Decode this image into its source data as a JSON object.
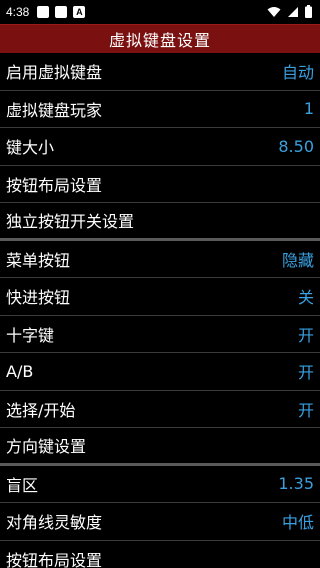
{
  "status": {
    "time": "4:38",
    "notif_a_glyph": "A"
  },
  "header": {
    "title": "虚拟键盘设置"
  },
  "rows": [
    {
      "label": "启用虚拟键盘",
      "value": "自动"
    },
    {
      "label": "虚拟键盘玩家",
      "value": "1"
    },
    {
      "label": "键大小",
      "value": "8.50"
    },
    {
      "label": "按钮布局设置",
      "value": ""
    },
    {
      "label": "独立按钮开关设置",
      "value": ""
    },
    {
      "label": "菜单按钮",
      "value": "隐藏"
    },
    {
      "label": "快进按钮",
      "value": "关"
    },
    {
      "label": "十字键",
      "value": "开"
    },
    {
      "label": "A/B",
      "value": "开"
    },
    {
      "label": "选择/开始",
      "value": "开"
    },
    {
      "label": "方向键设置",
      "value": ""
    },
    {
      "label": "盲区",
      "value": "1.35"
    },
    {
      "label": "对角线灵敏度",
      "value": "中低"
    },
    {
      "label": "按钮布局设置",
      "value": ""
    }
  ],
  "colors": {
    "accent": "#3aa0e0",
    "title_bar": "#7a1010"
  }
}
